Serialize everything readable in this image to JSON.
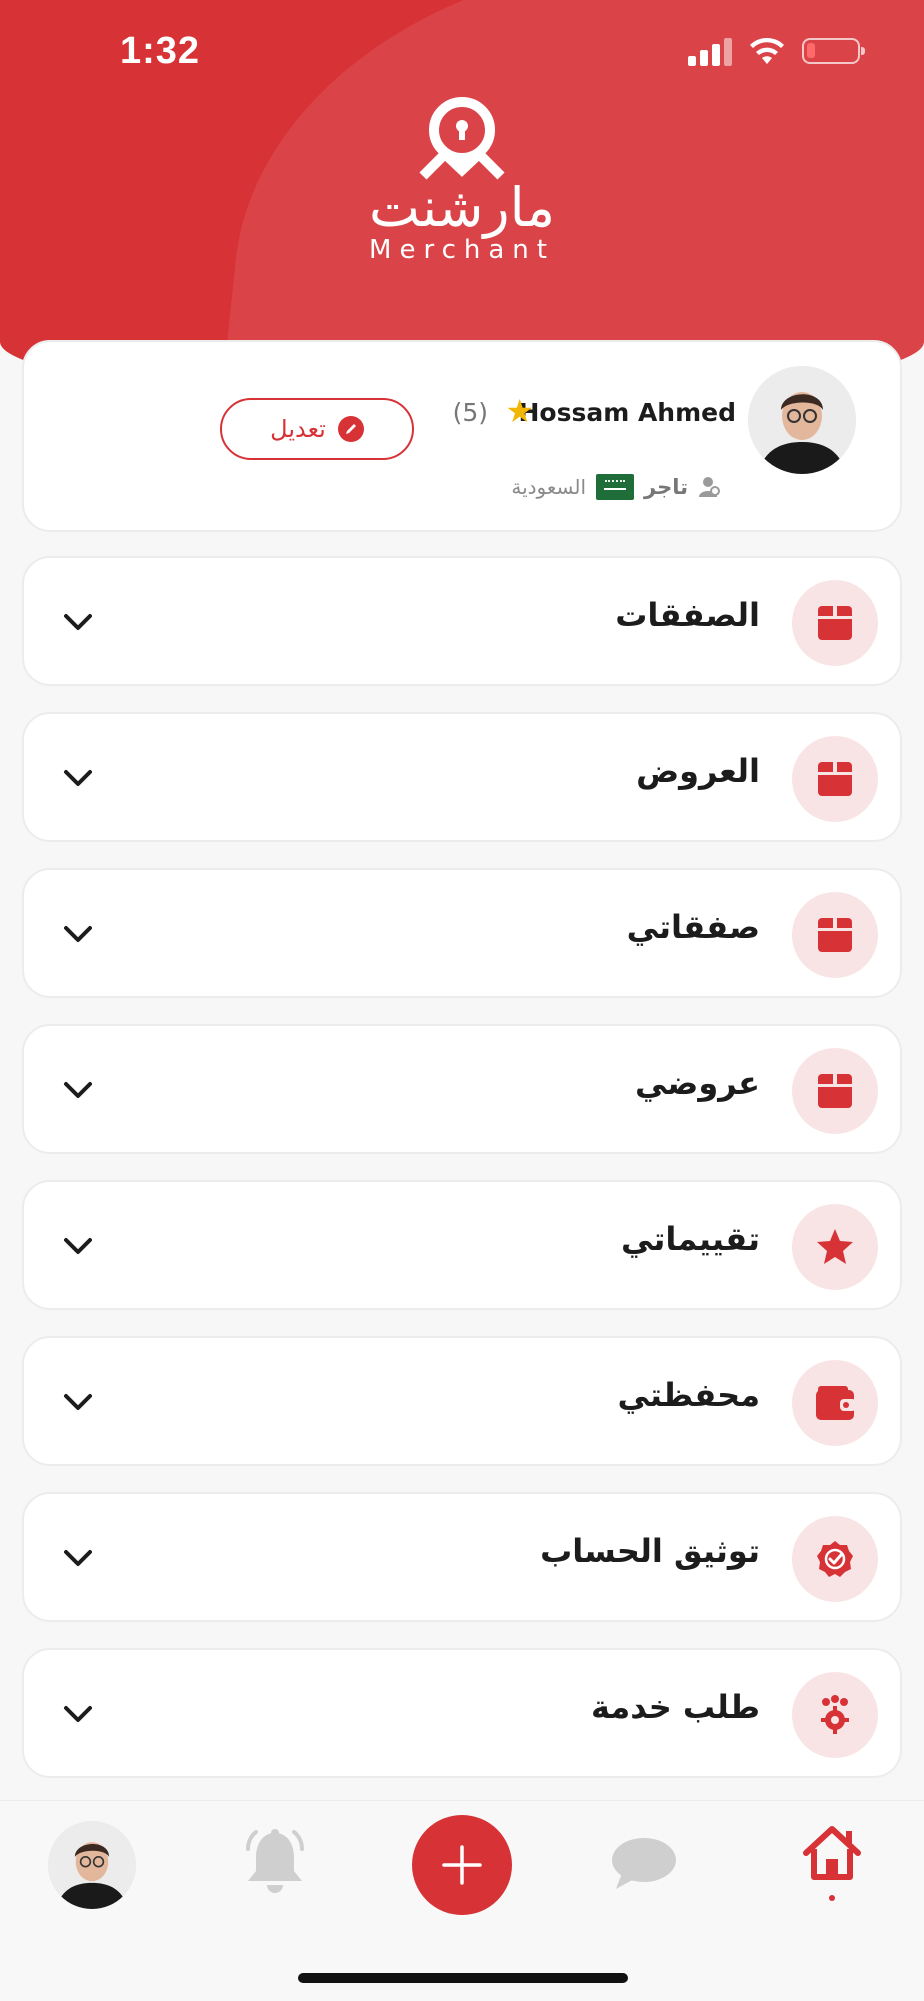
{
  "status_bar": {
    "time": "1:32"
  },
  "brand": {
    "name_ar": "مارشنت",
    "name_en": "Merchant"
  },
  "colors": {
    "primary": "#d73236",
    "icon_bg": "#f9e4e5",
    "gold": "#f2b705"
  },
  "profile": {
    "name": "Hossam Ahmed",
    "rating": "(5)",
    "role": "تاجر",
    "country": "السعودية",
    "edit_label": "تعديل"
  },
  "menu": [
    {
      "label": "الصفقات",
      "icon": "box-icon"
    },
    {
      "label": "العروض",
      "icon": "box-icon"
    },
    {
      "label": "صفقاتي",
      "icon": "box-icon"
    },
    {
      "label": "عروضي",
      "icon": "box-icon"
    },
    {
      "label": "تقييماتي",
      "icon": "star-icon"
    },
    {
      "label": "محفظتي",
      "icon": "wallet-icon"
    },
    {
      "label": "توثيق الحساب",
      "icon": "verified-badge-icon"
    },
    {
      "label": "طلب خدمة",
      "icon": "service-gear-icon"
    }
  ],
  "bottom_nav": [
    "profile",
    "notifications",
    "add",
    "chat",
    "home"
  ]
}
